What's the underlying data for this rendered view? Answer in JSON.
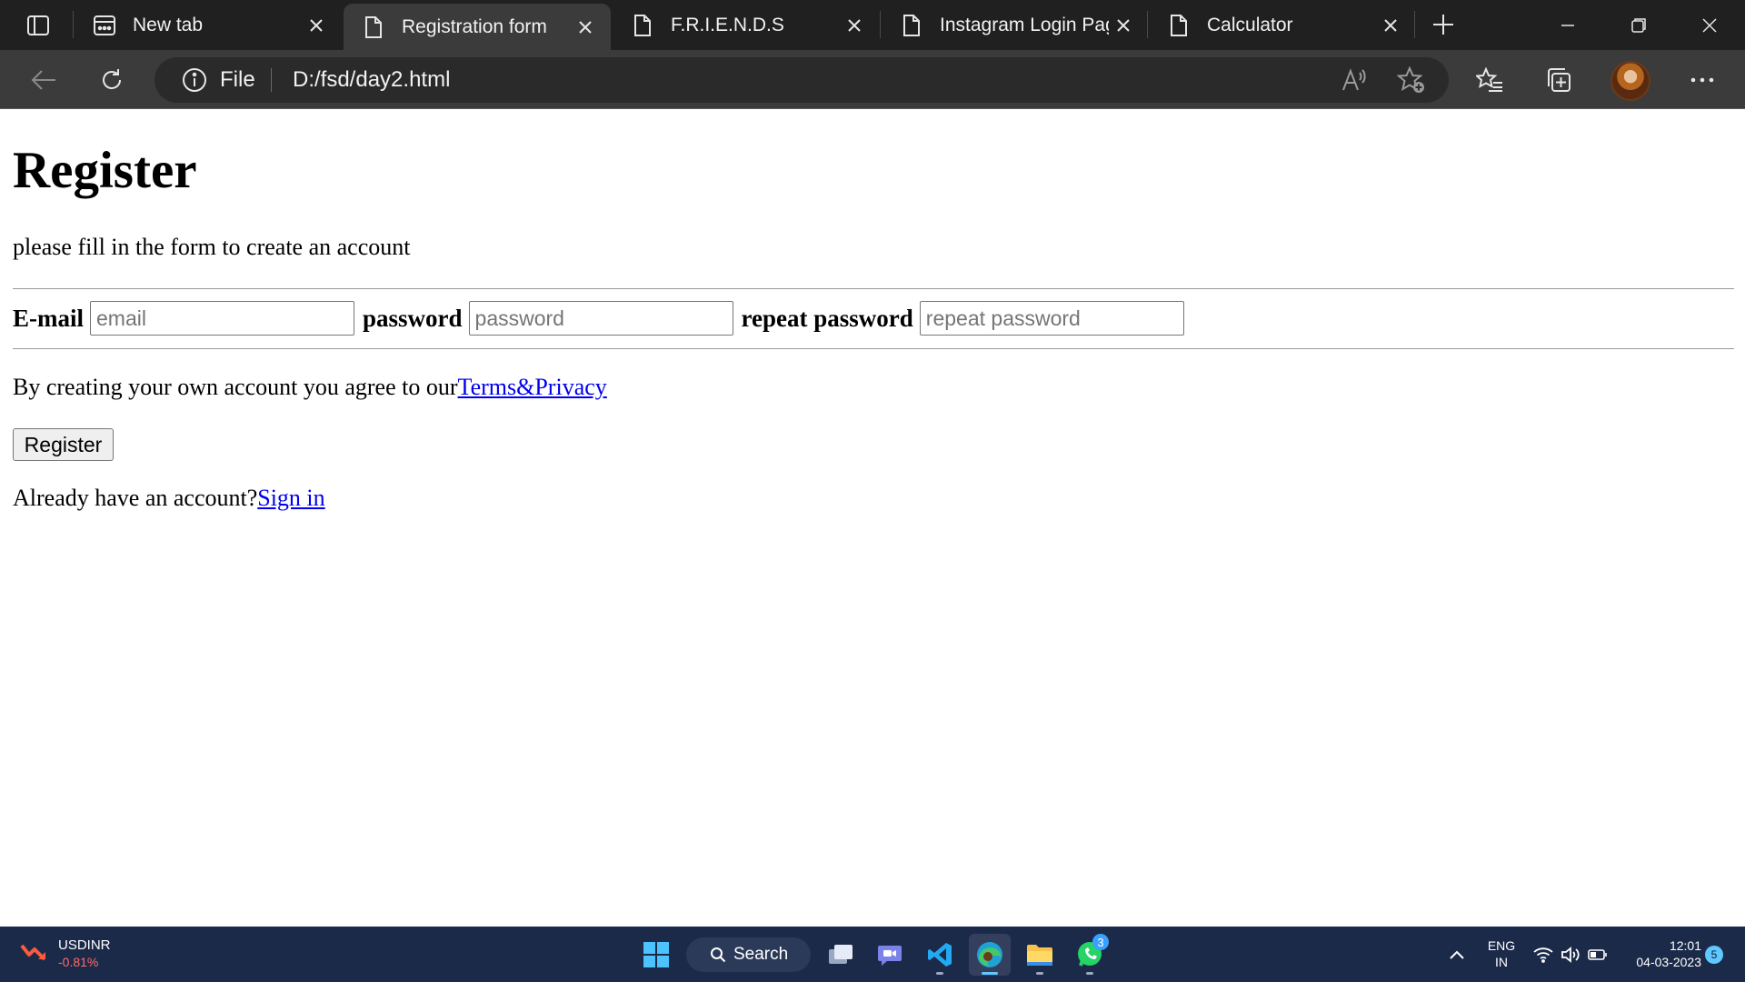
{
  "browser": {
    "tabs": [
      {
        "title": "New tab",
        "icon": "newtab-icon",
        "active": false
      },
      {
        "title": "Registration form",
        "icon": "page-icon",
        "active": true
      },
      {
        "title": "F.R.I.E.N.D.S",
        "icon": "page-icon",
        "active": false
      },
      {
        "title": "Instagram Login Pag",
        "icon": "page-icon",
        "active": false
      },
      {
        "title": "Calculator",
        "icon": "page-icon",
        "active": false
      }
    ],
    "address": {
      "scheme_label": "File",
      "url": "D:/fsd/day2.html"
    }
  },
  "page": {
    "heading": "Register",
    "subtitle": "please fill in the form to create an account",
    "fields": {
      "email_label": "E-mail",
      "email_placeholder": "email",
      "password_label": "password",
      "password_placeholder": "password",
      "repeat_label": "repeat password",
      "repeat_placeholder": "repeat password"
    },
    "terms_text": "By creating your own account you agree to our",
    "terms_link": "Terms&Privacy",
    "register_button": "Register",
    "signin_text": "Already have an account?",
    "signin_link": "Sign in"
  },
  "taskbar": {
    "ticker_symbol": "USDINR",
    "ticker_change": "-0.81%",
    "search_label": "Search",
    "whatsapp_badge": "3",
    "language": "ENG",
    "region": "IN",
    "time": "12:01",
    "date": "04-03-2023",
    "notification_count": "5"
  },
  "colors": {
    "tabbar_bg": "#202020",
    "toolbar_bg": "#3b3b3b",
    "link": "#0000ee",
    "taskbar_bg": "#1c2a4a",
    "ticker_negative": "#ff6b6b"
  }
}
